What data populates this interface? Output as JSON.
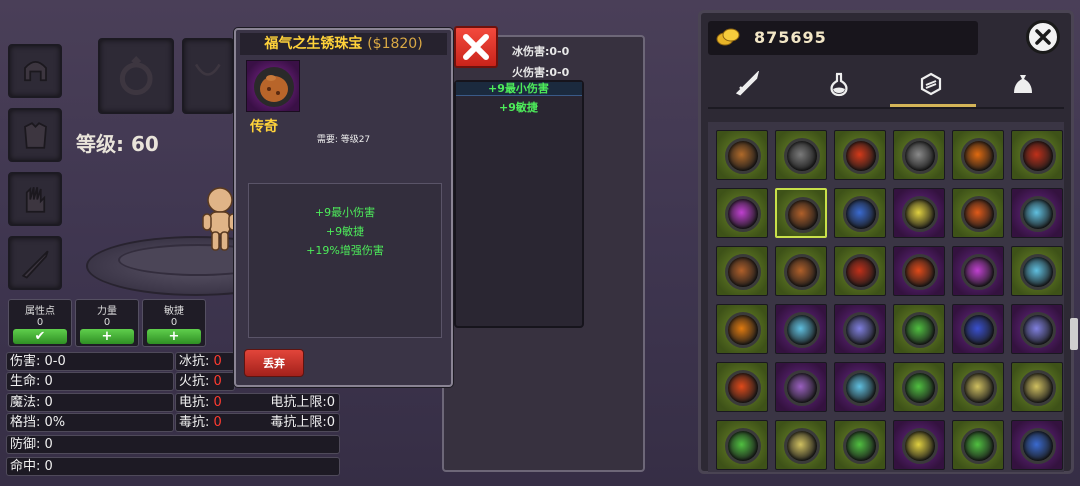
{
  "character": {
    "level_label": "等级: 60",
    "attributes": [
      {
        "label": "属性点",
        "value": "0",
        "button": "✔"
      },
      {
        "label": "力量",
        "value": "0",
        "button": "+"
      },
      {
        "label": "敏捷",
        "value": "0",
        "button": "+"
      }
    ],
    "stats": {
      "damage": "伤害: 0-0",
      "life": "生命: 0",
      "mana": "魔法: 0",
      "block": "格挡: 0%",
      "defense": "防御: 0",
      "hit": "命中: 0",
      "ice_res_label": "冰抗: ",
      "ice_res_value": "0",
      "fire_res_label": "火抗: ",
      "fire_res_value": "0",
      "light_res_label": "电抗: ",
      "light_res_value": "0",
      "poison_res_label": "毒抗: ",
      "poison_res_value": "0",
      "light_res_cap": "电抗上限:0",
      "poison_res_cap": "毒抗上限:0"
    }
  },
  "item_tooltip": {
    "name": "福气之生锈珠宝",
    "price": "($1820)",
    "rarity": "传奇",
    "requirement": "需要: 等级27",
    "bonuses": [
      "+9最小伤害",
      "+9敏捷",
      "+19%增强伤害"
    ],
    "discard_label": "丢弃"
  },
  "compare_panel": {
    "ice_damage": "冰伤害:0-0",
    "fire_damage": "火伤害:0-0",
    "bonus_1": "+9最小伤害",
    "bonus_2": "+9敏捷"
  },
  "inventory": {
    "gold": "875695",
    "tabs": [
      "sword-icon",
      "potion-icon",
      "gem-icon",
      "bag-icon"
    ],
    "active_tab": 2,
    "selected_cell": 7,
    "cells": [
      [
        "green",
        "#b06a2a"
      ],
      [
        "green",
        "#7a7a7a"
      ],
      [
        "green",
        "#d43a1a"
      ],
      [
        "green",
        "#8a8a8a"
      ],
      [
        "green",
        "#e06a10"
      ],
      [
        "green",
        "#c0301a"
      ],
      [
        "green",
        "#c040d0"
      ],
      [
        "green",
        "#b0602a"
      ],
      [
        "green",
        "#3a6ad0"
      ],
      [
        "purple",
        "#e0d040"
      ],
      [
        "green",
        "#e05a1a"
      ],
      [
        "purple",
        "#60c0e0"
      ],
      [
        "green",
        "#b0602a"
      ],
      [
        "green",
        "#b0602a"
      ],
      [
        "green",
        "#c0301a"
      ],
      [
        "purple",
        "#e04a1a"
      ],
      [
        "purple",
        "#c040d0"
      ],
      [
        "green",
        "#60c0e0"
      ],
      [
        "green",
        "#e07a10"
      ],
      [
        "purple",
        "#60c0e0"
      ],
      [
        "purple",
        "#8080e0"
      ],
      [
        "green",
        "#50c040"
      ],
      [
        "purple",
        "#3a50d0"
      ],
      [
        "purple",
        "#8080e0"
      ],
      [
        "green",
        "#e04a1a"
      ],
      [
        "purple",
        "#9a60c0"
      ],
      [
        "purple",
        "#60c0e0"
      ],
      [
        "green",
        "#50c040"
      ],
      [
        "green",
        "#d0c060"
      ],
      [
        "green",
        "#d0c060"
      ],
      [
        "green",
        "#50c040"
      ],
      [
        "green",
        "#d0c060"
      ],
      [
        "green",
        "#50c040"
      ],
      [
        "purple",
        "#e0d040"
      ],
      [
        "green",
        "#50c040"
      ],
      [
        "purple",
        "#3a6ad0"
      ]
    ],
    "colors": {
      "gold_text": "#f2e6c6",
      "legendary": "#ffd23a",
      "bonus": "#4ded5a",
      "resist_value": "#ff3b30"
    }
  }
}
